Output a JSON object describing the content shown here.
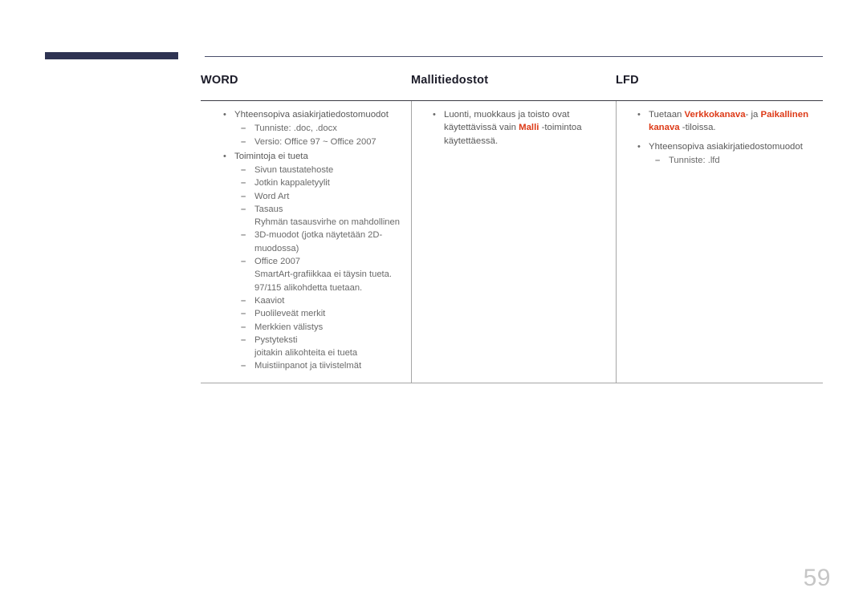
{
  "page": {
    "number": "59",
    "accent_color": "#dd3a17",
    "navy_color": "#2e3352"
  },
  "table": {
    "columns": [
      {
        "header": "WORD",
        "items": [
          {
            "text": "Yhteensopiva asiakirjatiedostomuodot",
            "bullet": "•",
            "sub": [
              {
                "dash": "–",
                "text": "Tunniste: .doc, .docx"
              },
              {
                "dash": "–",
                "text": "Versio: Office 97 ~ Office 2007"
              }
            ]
          },
          {
            "text": "Toimintoja ei tueta",
            "bullet": "•",
            "sub": [
              {
                "dash": "–",
                "text": "Sivun taustatehoste"
              },
              {
                "dash": "–",
                "text": "Jotkin kappaletyylit"
              },
              {
                "dash": "–",
                "text": "Word Art"
              },
              {
                "dash": "–",
                "text": "Tasaus",
                "cont": "Ryhmän tasausvirhe on mahdollinen"
              },
              {
                "dash": "–",
                "text": "3D-muodot (jotka näytetään 2D-muodossa)"
              },
              {
                "dash": "–",
                "text": "Office 2007",
                "cont": "SmartArt-grafiikkaa ei täysin tueta. 97/115 alikohdetta tuetaan."
              },
              {
                "dash": "–",
                "text": "Kaaviot"
              },
              {
                "dash": "–",
                "text": "Puolileveät merkit"
              },
              {
                "dash": "–",
                "text": "Merkkien välistys"
              },
              {
                "dash": "–",
                "text": "Pystyteksti",
                "cont": "joitakin alikohteita ei tueta"
              },
              {
                "dash": "–",
                "text": "Muistiinpanot ja tiivistelmät"
              }
            ]
          }
        ]
      },
      {
        "header": "Mallitiedostot",
        "items": [
          {
            "bullet": "•",
            "rich": [
              {
                "t": "Luonti, muokkaus ja toisto ovat käytettävissä vain ",
                "accent": false
              },
              {
                "t": "Malli",
                "accent": true
              },
              {
                "t": " -toimintoa käytettäessä.",
                "accent": false
              }
            ]
          }
        ]
      },
      {
        "header": "LFD",
        "items": [
          {
            "bullet": "•",
            "rich": [
              {
                "t": "Tuetaan ",
                "accent": false
              },
              {
                "t": "Verkkokanava",
                "accent": true
              },
              {
                "t": "- ja ",
                "accent": false
              },
              {
                "t": "Paikallinen kanava",
                "accent": true
              },
              {
                "t": " -tiloissa.",
                "accent": false
              }
            ]
          },
          {
            "bullet": "•",
            "text": "Yhteensopiva asiakirjatiedostomuodot",
            "sub": [
              {
                "dash": "–",
                "text": "Tunniste: .lfd"
              }
            ]
          }
        ]
      }
    ]
  }
}
